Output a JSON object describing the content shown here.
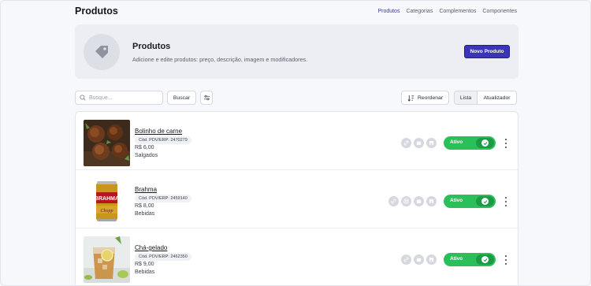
{
  "header": {
    "title": "Produtos",
    "nav": [
      {
        "label": "Produtos",
        "active": true
      },
      {
        "label": "Categorias",
        "active": false
      },
      {
        "label": "Complementos",
        "active": false
      },
      {
        "label": "Componentes",
        "active": false
      }
    ]
  },
  "hero": {
    "icon": "tag-icon",
    "title": "Produtos",
    "subtitle": "Adicione e edite produtos: preço, descrição, imagem e modificadores.",
    "new_button": "Novo Produto"
  },
  "toolbar": {
    "search_placeholder": "Busque...",
    "search_button": "Buscar",
    "filter_icon": "sliders-icon",
    "reorder_label": "Reordenar",
    "view_list": "Lista",
    "view_refresh": "Atualizador"
  },
  "products": [
    {
      "name": "Bolinho de carne",
      "code": "Cód. PDV/ERP: 2470279",
      "price": "R$ 6,00",
      "category": "Salgados",
      "status": "Ativo",
      "image": "fried-meatballs",
      "icons": [
        "link-icon",
        "calendar-icon",
        "store-icon"
      ]
    },
    {
      "name": "Brahma",
      "code": "Cód. PDV/ERP: 2459140",
      "price": "R$ 8,00",
      "category": "Bebidas",
      "status": "Ativo",
      "image": "beer-can",
      "icons": [
        "link-icon",
        "instagram-icon",
        "calendar-icon",
        "store-icon"
      ]
    },
    {
      "name": "Chá-gelado",
      "code": "Cód. PDV/ERP: 2462350",
      "price": "R$ 9,00",
      "category": "Bebidas",
      "status": "Ativo",
      "image": "iced-tea",
      "icons": [
        "link-icon",
        "calendar-icon",
        "store-icon"
      ]
    }
  ],
  "colors": {
    "accent": "#3a35b8",
    "active_toggle": "#2bbf5a",
    "nav_active": "#3b3aa8"
  }
}
